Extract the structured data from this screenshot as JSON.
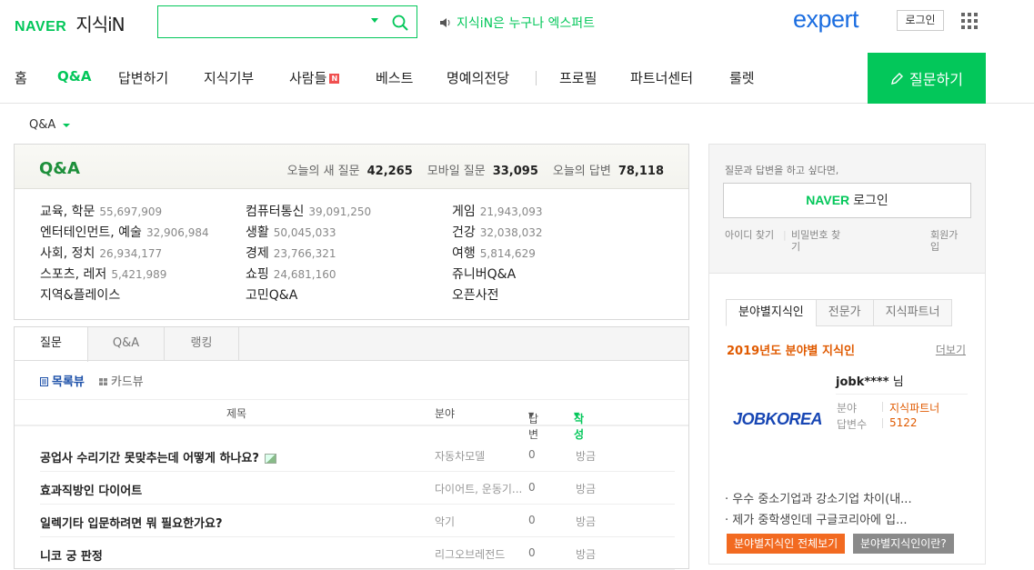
{
  "header": {
    "brand": "NAVER",
    "service": "지식iN",
    "search_placeholder": "",
    "notice": "지식iN은 누구나 엑스퍼트",
    "expert": "expert",
    "login": "로그인"
  },
  "nav": {
    "items": [
      "홈",
      "Q&A",
      "답변하기",
      "지식기부",
      "사람들",
      "베스트",
      "명예의전당",
      "프로필",
      "파트너센터",
      "룰렛"
    ],
    "badge": "N",
    "active": "Q&A",
    "ask": "질문하기"
  },
  "breadcrumb": "Q&A",
  "qa": {
    "title": "Q&A",
    "stats": [
      {
        "label": "오늘의 새 질문",
        "value": "42,265"
      },
      {
        "label": "모바일 질문",
        "value": "33,095"
      },
      {
        "label": "오늘의 답변",
        "value": "78,118"
      }
    ],
    "categories": [
      {
        "name": "교육, 학문",
        "count": "55,697,909"
      },
      {
        "name": "엔터테인먼트, 예술",
        "count": "32,906,984"
      },
      {
        "name": "사회, 정치",
        "count": "26,934,177"
      },
      {
        "name": "스포츠, 레저",
        "count": "5,421,989"
      },
      {
        "name": "지역&플레이스",
        "count": ""
      },
      {
        "name": "컴퓨터통신",
        "count": "39,091,250"
      },
      {
        "name": "생활",
        "count": "50,045,033"
      },
      {
        "name": "경제",
        "count": "23,766,321"
      },
      {
        "name": "쇼핑",
        "count": "24,681,160"
      },
      {
        "name": "고민Q&A",
        "count": ""
      },
      {
        "name": "게임",
        "count": "21,943,093"
      },
      {
        "name": "건강",
        "count": "32,038,032"
      },
      {
        "name": "여행",
        "count": "5,814,629"
      },
      {
        "name": "쥬니버Q&A",
        "count": ""
      },
      {
        "name": "오픈사전",
        "count": ""
      }
    ]
  },
  "tabs": [
    "질문",
    "Q&A",
    "랭킹"
  ],
  "views": {
    "list": "목록뷰",
    "card": "카드뷰"
  },
  "columns": {
    "title": "제목",
    "category": "분야",
    "answers": "답변",
    "author": "작성"
  },
  "rows": [
    {
      "title": "공업사 수리기간 못맞추는데 어떻게 하나요?",
      "category": "자동차모델",
      "answers": "0",
      "time": "방금",
      "hasImage": true
    },
    {
      "title": "효과직방인 다이어트",
      "category": "다이어트, 운동기...",
      "answers": "0",
      "time": "방금",
      "hasImage": false
    },
    {
      "title": "일렉기타 입문하려면 뭐 필요한가요?",
      "category": "악기",
      "answers": "0",
      "time": "방금",
      "hasImage": false
    },
    {
      "title": "니코 궁 판정",
      "category": "리그오브레전드",
      "answers": "0",
      "time": "방금",
      "hasImage": false
    }
  ],
  "side": {
    "msg": "질문과 답변을 하고 싶다면,",
    "login_brand": "NAVER",
    "login_label": "로그인",
    "find_id": "아이디 찾기",
    "find_pw": "비밀번호 찾기",
    "join": "회원가입",
    "tabs": [
      "분야별지식인",
      "전문가",
      "지식파트너"
    ],
    "year_title": "2019년도 분야별 지식인",
    "more": "더보기",
    "user": {
      "name": "jobk****",
      "suffix": "님",
      "logo": "JOBKOREA",
      "field_label": "분야",
      "field": "지식파트너",
      "count_label": "답변수",
      "count": "5122"
    },
    "bullets": [
      "제가 중학생인데 구글코리아에 입...",
      "우수 중소기업과 강소기업 차이(내..."
    ],
    "btn_all": "분야별지식인 전체보기",
    "btn_what": "분야별지식인이란?"
  },
  "colors": {
    "green": "#03c75a",
    "orange": "#e05a00",
    "expert_blue": "#1b6de0"
  }
}
